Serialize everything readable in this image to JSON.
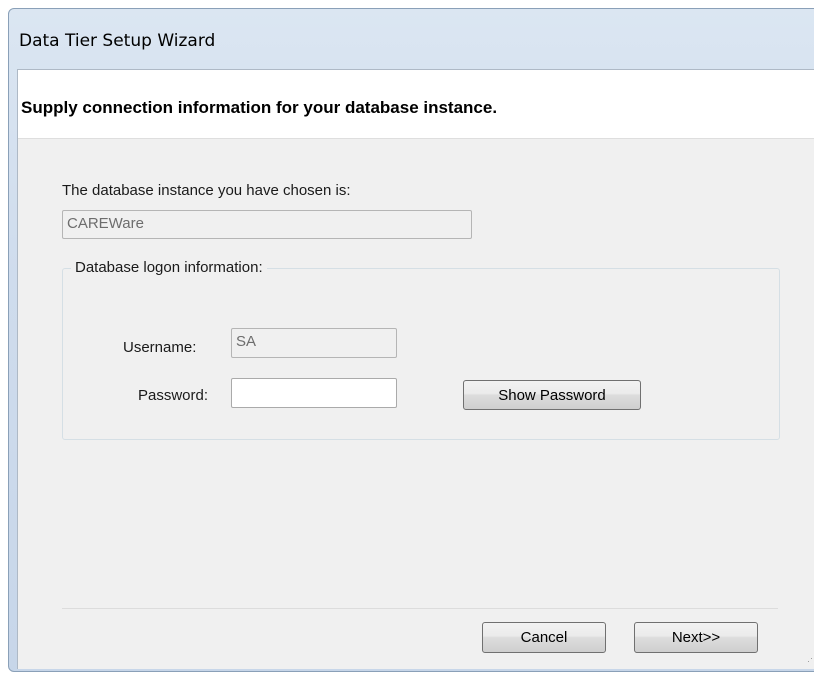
{
  "window": {
    "title": "Data Tier Setup Wizard"
  },
  "header": {
    "text": "Supply connection information for your database instance."
  },
  "instance": {
    "label": "The database instance you have chosen is:",
    "value": "CAREWare"
  },
  "logon_group": {
    "legend": "Database logon information:",
    "username_label": "Username:",
    "username_value": "SA",
    "password_label": "Password:",
    "password_value": "",
    "show_password_button": "Show Password"
  },
  "footer": {
    "cancel_button": "Cancel",
    "next_button": "Next>>"
  },
  "icons": {
    "resize_grip": "resize-grip-icon"
  }
}
